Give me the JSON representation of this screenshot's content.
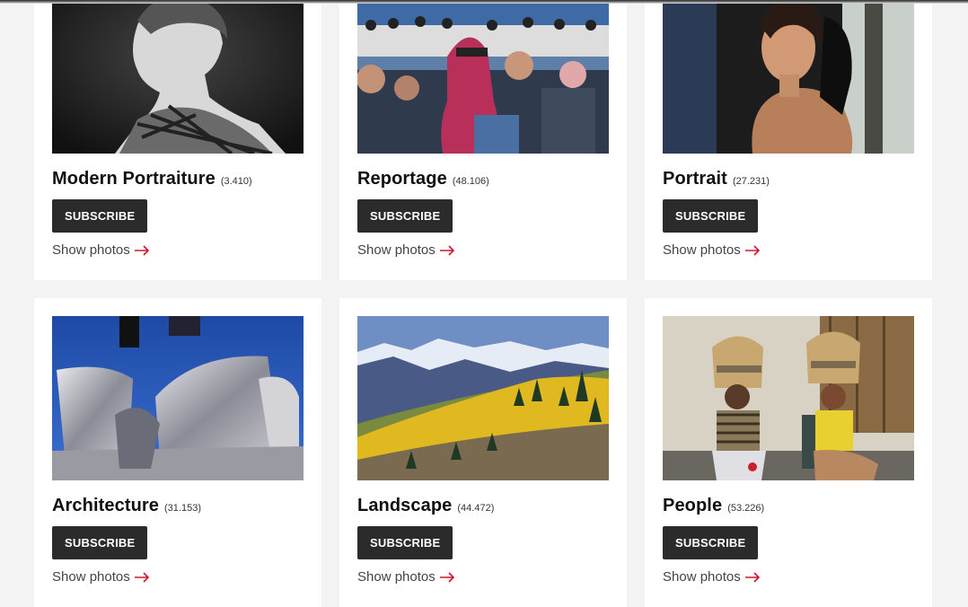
{
  "categories": [
    {
      "title": "Modern Portraiture",
      "count": "(3.410)",
      "subscribe": "SUBSCRIBE",
      "show": "Show photos"
    },
    {
      "title": "Reportage",
      "count": "(48.106)",
      "subscribe": "SUBSCRIBE",
      "show": "Show photos"
    },
    {
      "title": "Portrait",
      "count": "(27.231)",
      "subscribe": "SUBSCRIBE",
      "show": "Show photos"
    },
    {
      "title": "Architecture",
      "count": "(31.153)",
      "subscribe": "SUBSCRIBE",
      "show": "Show photos"
    },
    {
      "title": "Landscape",
      "count": "(44.472)",
      "subscribe": "SUBSCRIBE",
      "show": "Show photos"
    },
    {
      "title": "People",
      "count": "(53.226)",
      "subscribe": "SUBSCRIBE",
      "show": "Show photos"
    }
  ],
  "colors": {
    "page_background": "#f3f3f3",
    "card_background": "#ffffff",
    "button_background": "#2b2b2b",
    "button_text": "#ffffff",
    "arrow_accent": "#d0162e"
  },
  "icons": {
    "show_photos": "arrow-right-icon"
  }
}
